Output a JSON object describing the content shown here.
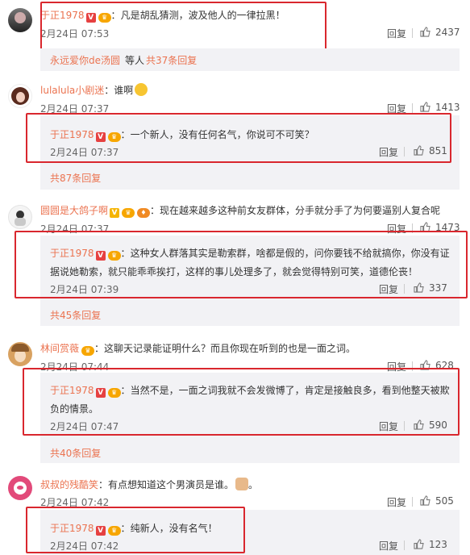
{
  "reply_label": "回复",
  "comments": [
    {
      "user": "于正1978",
      "text": "凡是胡乱猜测，波及他人的一律拉黑！",
      "time": "2月24日 07:53",
      "likes": "2437",
      "summary_user": "永远爱你de汤圆",
      "summary_mid": "等人",
      "summary_count": "共37条回复"
    },
    {
      "user": "lulalula小剧迷",
      "text": "谁啊",
      "time": "2月24日 07:37",
      "likes": "1413",
      "reply": {
        "user": "于正1978",
        "text": "一个新人，没有任何名气，你说可不可笑？",
        "time": "2月24日 07:37",
        "likes": "851"
      },
      "more": "共87条回复"
    },
    {
      "user": "圆圆是大鸽子啊",
      "text": "现在越来越多这种前女友群体，分手就分手了为何要逼别人复合呢",
      "time": "2月24日 07:37",
      "likes": "1473",
      "reply": {
        "user": "于正1978",
        "text1": "这种女人群落其实是勒索群，啥都是假的，问你要钱不给就搞你，你没有证",
        "text2": "据说她勒索，就只能乖乖挨打，这样的事儿处理多了，就会觉得特别可笑，道德伦丧！",
        "time": "2月24日 07:39",
        "likes": "337"
      },
      "more": "共45条回复"
    },
    {
      "user": "林间赏薇",
      "text": "这聊天记录能证明什么？而且你现在听到的也是一面之词。",
      "time": "2月24日 07:44",
      "likes": "628",
      "reply": {
        "user": "于正1978",
        "text1": "当然不是，一面之词我就不会发微博了，肯定是接触良多，看到他整天被欺",
        "text2": "负的情景。",
        "time": "2月24日 07:47",
        "likes": "590"
      },
      "more": "共40条回复"
    },
    {
      "user": "叔叔的残酷笑",
      "text": "有点想知道这个男演员是谁。",
      "time": "2月24日 07:42",
      "likes": "505",
      "reply": {
        "user": "于正1978",
        "text": "纯新人，没有名气！",
        "time": "2月24日 07:42",
        "likes": "123"
      }
    }
  ],
  "colors": {
    "username": "#eb7350",
    "highlight_box": "#d9272e",
    "reply_bg": "#f2f2f5"
  }
}
